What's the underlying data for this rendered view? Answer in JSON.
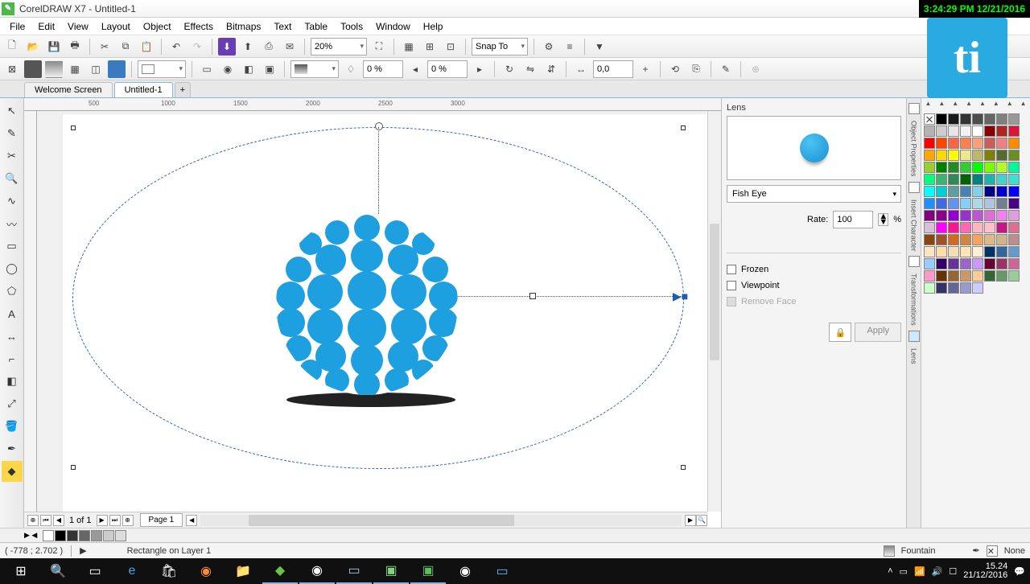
{
  "title": "CorelDRAW X7 - Untitled-1",
  "clock_overlay": "3:24:29 PM 12/21/2016",
  "menu": [
    "File",
    "Edit",
    "View",
    "Layout",
    "Object",
    "Effects",
    "Bitmaps",
    "Text",
    "Table",
    "Tools",
    "Window",
    "Help"
  ],
  "toolbar1": {
    "zoom": "20%",
    "snap_label": "Snap To"
  },
  "toolbar2": {
    "opacity1": "0 %",
    "opacity2": "0 %",
    "value3": "0,0"
  },
  "doc_tabs": {
    "tab1": "Welcome Screen",
    "tab2": "Untitled-1"
  },
  "ruler_marks": [
    "500",
    "1000",
    "1500",
    "2000",
    "2500",
    "3000"
  ],
  "docker": {
    "title": "Lens",
    "mode": "Fish Eye",
    "rate_label": "Rate:",
    "rate_value": "100",
    "rate_unit": "%",
    "frozen": "Frozen",
    "viewpoint": "Viewpoint",
    "removeface": "Remove Face",
    "apply": "Apply"
  },
  "side_tabs": [
    "Object Properties",
    "Insert Character",
    "Transformations",
    "Lens"
  ],
  "page_nav": {
    "indicator": "1 of 1",
    "page_label": "Page 1"
  },
  "status": {
    "coords": "( -778 ; 2.702 )",
    "object": "Rectangle on Layer 1",
    "fill_label": "Fountain",
    "outline_label": "None"
  },
  "taskbar_clock": {
    "time": "15.24",
    "date": "21/12/2016"
  },
  "ti": "ti",
  "palette_colors": [
    "#000000",
    "#1a1a1a",
    "#333333",
    "#4d4d4d",
    "#666666",
    "#808080",
    "#999999",
    "#b3b3b3",
    "#cccccc",
    "#e6e6e6",
    "#f2f2f2",
    "#ffffff",
    "#8b0000",
    "#b22222",
    "#dc143c",
    "#ff0000",
    "#ff4500",
    "#ff6347",
    "#ff7f50",
    "#ffa07a",
    "#cd5c5c",
    "#f08080",
    "#ff8c00",
    "#ffa500",
    "#ffd700",
    "#ffff00",
    "#f0e68c",
    "#bdb76b",
    "#808000",
    "#556b2f",
    "#6b8e23",
    "#9acd32",
    "#008000",
    "#228b22",
    "#32cd32",
    "#00ff00",
    "#7cfc00",
    "#adff2f",
    "#00fa9a",
    "#00ff7f",
    "#3cb371",
    "#2e8b57",
    "#006400",
    "#008080",
    "#20b2aa",
    "#48d1cc",
    "#40e0d0",
    "#00ffff",
    "#00ced1",
    "#5f9ea0",
    "#4682b4",
    "#87ceeb",
    "#000080",
    "#0000cd",
    "#0000ff",
    "#1e90ff",
    "#4169e1",
    "#6495ed",
    "#87cefa",
    "#add8e6",
    "#b0c4de",
    "#708090",
    "#4b0082",
    "#800080",
    "#8b008b",
    "#9400d3",
    "#9932cc",
    "#ba55d3",
    "#da70d6",
    "#ee82ee",
    "#dda0dd",
    "#d8bfd8",
    "#ff00ff",
    "#ff1493",
    "#ff69b4",
    "#ffb6c1",
    "#ffc0cb",
    "#c71585",
    "#db7093",
    "#8b4513",
    "#a0522d",
    "#d2691e",
    "#cd853f",
    "#f4a460",
    "#deb887",
    "#d2b48c",
    "#bc8f8f",
    "#ffe4c4",
    "#ffdead",
    "#f5deb3",
    "#ffe4b5",
    "#ffefd5",
    "#003366",
    "#336699",
    "#6699cc",
    "#99ccff",
    "#330066",
    "#663399",
    "#9966cc",
    "#cc99ff",
    "#660033",
    "#993366",
    "#cc6699",
    "#ff99cc",
    "#663300",
    "#996633",
    "#cc9966",
    "#ffcc99",
    "#336633",
    "#669966",
    "#99cc99",
    "#ccffcc",
    "#333366",
    "#666699",
    "#9999cc",
    "#ccccff"
  ],
  "doc_palette": [
    "#000000",
    "#333333",
    "#666666",
    "#999999",
    "#cccccc",
    "#dddddd"
  ]
}
